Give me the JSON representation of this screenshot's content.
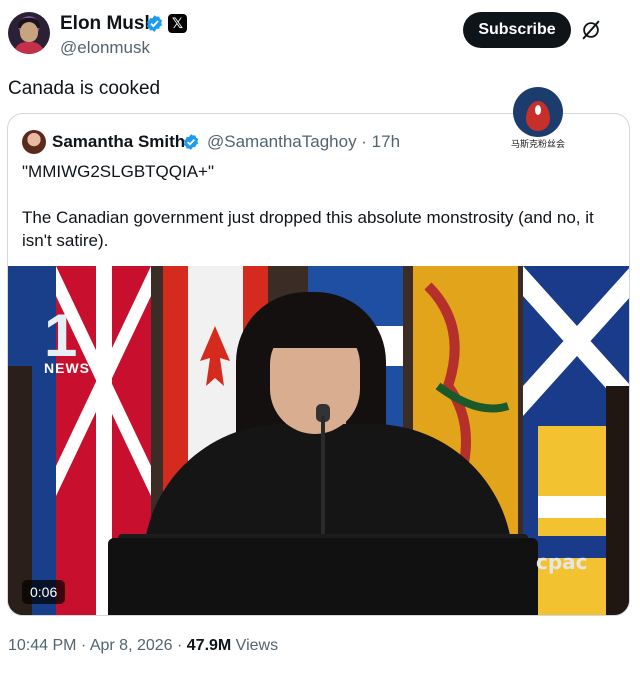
{
  "author": {
    "name": "Elon Musk",
    "handle": "@elonmusk",
    "x_badge": "𝕏"
  },
  "subscribe_label": "Subscribe",
  "tweet": {
    "text": "Canada is cooked"
  },
  "quoted_tweet": {
    "name": "Samantha Smith",
    "handle_time": "@SamanthaTaghoy · 17h",
    "line1": "\"MMIWG2SLGBTQQIA+\"",
    "body": "The Canadian government just dropped this absolute monstrosity (and no, it isn't satire)."
  },
  "watermark_text": "马斯克粉丝会",
  "video": {
    "duration": "0:06",
    "news_logo_number": "1",
    "news_logo_word": "NEWS",
    "network_logo": "cpac"
  },
  "meta": {
    "time_date": "10:44 PM · Apr 8, 2026 · ",
    "views_count": "47.9M",
    "views_label": " Views"
  },
  "colors": {
    "verified_blue": "#1d9bf0",
    "secondary_text": "#536471",
    "primary_text": "#0f1419"
  },
  "icons": [
    "verified-badge-icon",
    "x-logo-icon",
    "grok-icon"
  ]
}
